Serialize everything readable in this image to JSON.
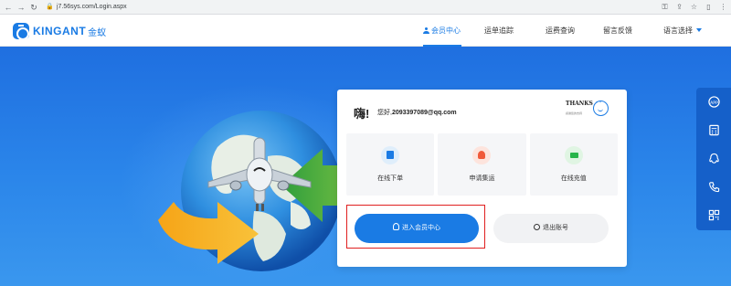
{
  "browser": {
    "url": "j7.56sys.com/Login.aspx"
  },
  "header": {
    "logo_text": "KINGANT",
    "logo_cn": "金蚁",
    "nav": [
      {
        "label": "会员中心",
        "active": true
      },
      {
        "label": "运单追踪",
        "active": false
      },
      {
        "label": "运费查询",
        "active": false
      },
      {
        "label": "留言反馈",
        "active": false
      },
      {
        "label": "语言选择",
        "active": false
      }
    ]
  },
  "card": {
    "greeting": "嗨!",
    "hello": "您好,",
    "user_email": "2093397089@qq.com",
    "thanks": "THANKS",
    "thanks_sub": "感谢您的支持",
    "services": [
      {
        "label": "在线下单",
        "icon": "order-icon"
      },
      {
        "label": "申请集运",
        "icon": "consolidate-icon"
      },
      {
        "label": "在线充值",
        "icon": "recharge-icon"
      }
    ],
    "enter_button": "进入会员中心",
    "logout_button": "退出账号"
  },
  "sidebar": {
    "buttons": [
      "app-icon",
      "calculator-icon",
      "qq-icon",
      "phone-icon",
      "qrcode-icon"
    ]
  },
  "colors": {
    "brand": "#1a7be4",
    "hero_top": "#1f6fe0",
    "highlight": "#e02020"
  }
}
